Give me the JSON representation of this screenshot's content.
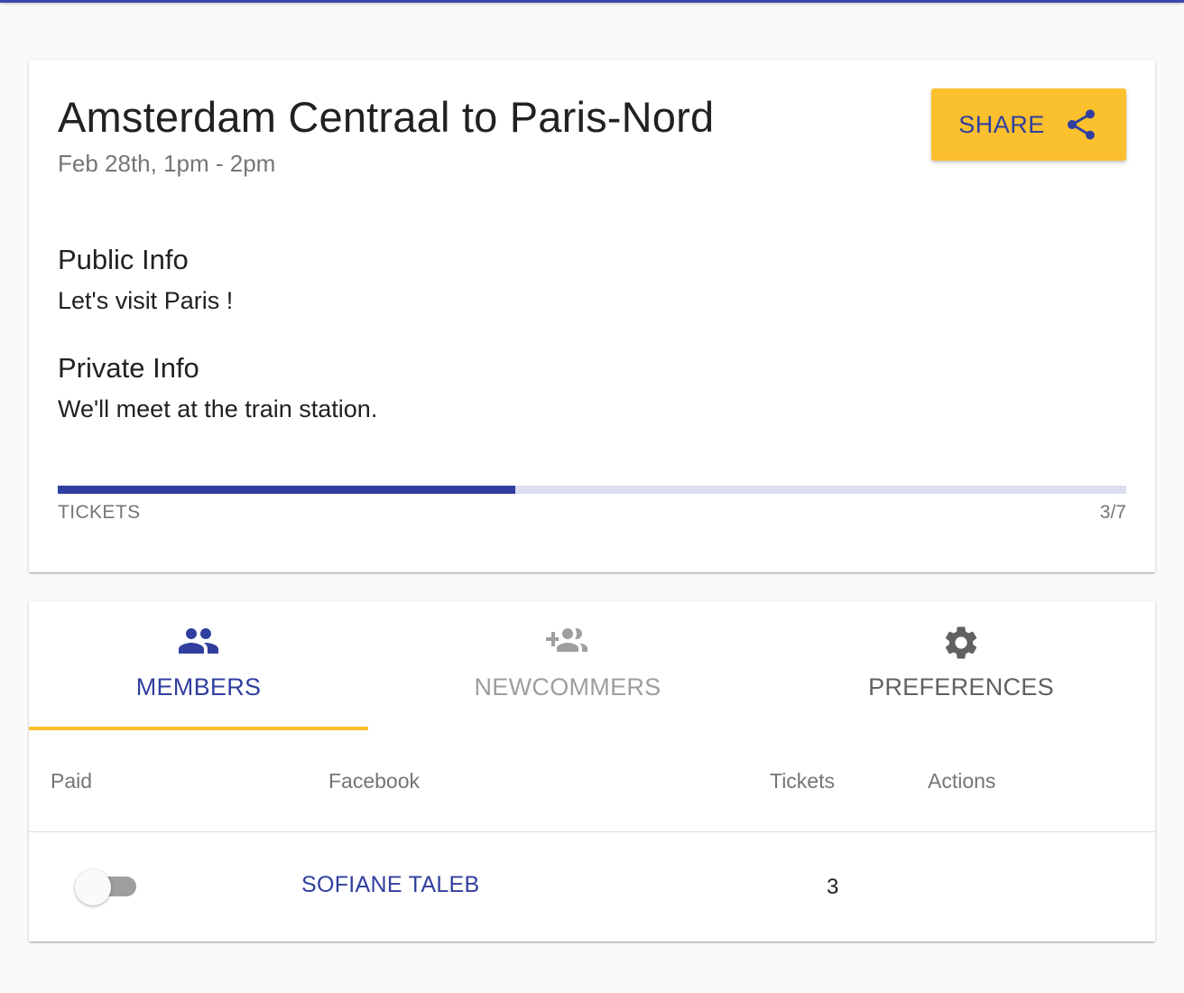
{
  "event": {
    "title": "Amsterdam Centraal to Paris-Nord",
    "date": "Feb 28th, 1pm - 2pm",
    "share_label": "SHARE",
    "share_icon": "share-icon"
  },
  "info": {
    "public_heading": "Public Info",
    "public_text": "Let's visit Paris !",
    "private_heading": "Private Info",
    "private_text": "We'll meet at the train station."
  },
  "tickets": {
    "label": "TICKETS",
    "count_text": "3/7",
    "sold": 3,
    "total": 7
  },
  "tabs": [
    {
      "label": "MEMBERS",
      "icon": "group-icon",
      "active": true
    },
    {
      "label": "NEWCOMMERS",
      "icon": "group-add-icon",
      "active": false
    },
    {
      "label": "PREFERENCES",
      "icon": "gear-icon",
      "active": false
    }
  ],
  "table": {
    "headers": [
      "Paid",
      "Facebook",
      "Tickets",
      "Actions"
    ],
    "rows": [
      {
        "paid": false,
        "facebook": "SOFIANE TALEB",
        "tickets": "3"
      }
    ]
  },
  "colors": {
    "primary": "#303f9f",
    "accent": "#fbc02d",
    "progress_track": "#dadef0",
    "inactive_tab": "#9e9e9e",
    "muted_text": "#757575"
  }
}
